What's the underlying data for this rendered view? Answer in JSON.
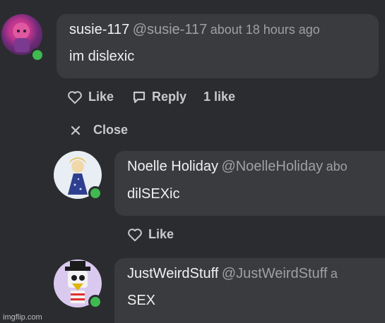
{
  "comments": [
    {
      "name": "susie-117",
      "handle": "@susie-117",
      "time": "about 18 hours ago",
      "text": "im dislexic",
      "actions": {
        "like": "Like",
        "reply": "Reply",
        "likes_count": "1 like"
      }
    },
    {
      "name": "Noelle Holiday",
      "handle": "@NoelleHoliday",
      "time": "abo",
      "text": "dilSEXic",
      "actions": {
        "like": "Like"
      }
    },
    {
      "name": "JustWeirdStuff",
      "handle": "@JustWeirdStuff",
      "time": "a",
      "text": "SEX"
    }
  ],
  "thread": {
    "close_label": "Close"
  },
  "watermark": "imgflip.com",
  "colors": {
    "background": "#2b2c2f",
    "bubble": "#3a3b3f",
    "online": "#3fb950",
    "muted": "#a0a0a4"
  },
  "icons": {
    "like": "heart-outline-icon",
    "reply": "speech-bubble-icon",
    "close": "x-icon"
  }
}
